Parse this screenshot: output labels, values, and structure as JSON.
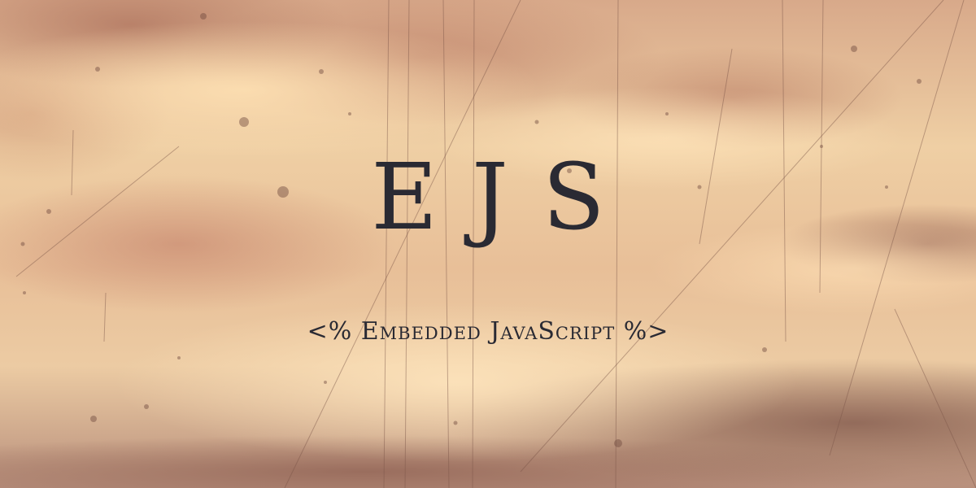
{
  "banner": {
    "title": "EJS",
    "subtitle": "<% Embedded JavaScript %>"
  },
  "colors": {
    "text": "#2a2a33",
    "sky_light": "#efcfa4",
    "sky_dark": "#b88f7c"
  }
}
